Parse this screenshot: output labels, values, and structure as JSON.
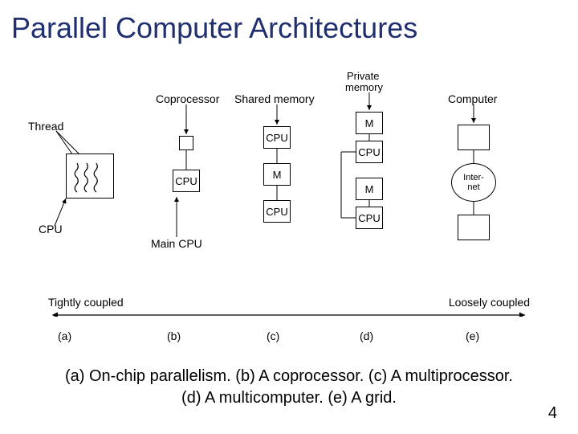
{
  "title": "Parallel Computer Architectures",
  "labels": {
    "thread": "Thread",
    "cpu": "CPU",
    "coprocessor": "Coprocessor",
    "main_cpu": "Main CPU",
    "shared_memory": "Shared memory",
    "private_memory": "Private memory",
    "computer": "Computer",
    "M": "M",
    "internet": "Inter-\nnet"
  },
  "axis": {
    "left": "Tightly coupled",
    "right": "Loosely coupled"
  },
  "columns": [
    "(a)",
    "(b)",
    "(c)",
    "(d)",
    "(e)"
  ],
  "caption_line1": "(a) On-chip parallelism. (b) A coprocessor. (c) A multiprocessor.",
  "caption_line2": "(d) A multicomputer. (e) A grid.",
  "page_number": "4"
}
